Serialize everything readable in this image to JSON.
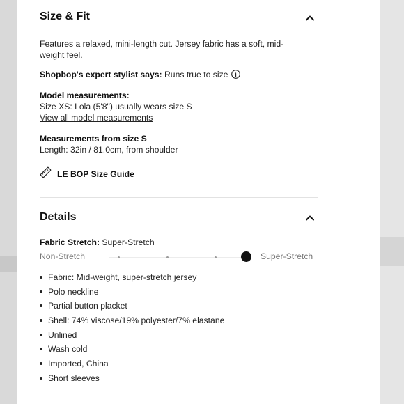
{
  "size_fit": {
    "title": "Size & Fit",
    "description_line1": "Features a relaxed, mini-length cut. Jersey fabric has a soft, mid-",
    "description_line2": "weight feel.",
    "stylist_label": "Shopbop's expert stylist says:",
    "stylist_value": " Runs true to size",
    "model_heading": "Model measurements:",
    "model_text": "Size XS: Lola (5'8\") usually wears size S",
    "model_link": "View all model measurements",
    "measure_heading": "Measurements from size S",
    "measure_text": "Length: 32in / 81.0cm, from shoulder",
    "size_guide_link": "LE BOP Size Guide",
    "icons": {
      "collapse": "chevron-up-icon",
      "info": "info-icon",
      "ruler": "ruler-icon"
    }
  },
  "details": {
    "title": "Details",
    "stretch_label": "Fabric Stretch:",
    "stretch_value": " Super-Stretch",
    "stretch_min": "Non-Stretch",
    "stretch_max": "Super-Stretch",
    "stretch_level": 1.0,
    "bullets": [
      "Fabric: Mid-weight, super-stretch jersey",
      "Polo neckline",
      "Partial button placket",
      "Shell: 74% viscose/19% polyester/7% elastane",
      "Unlined",
      "Wash cold",
      "Imported, China",
      "Short sleeves"
    ]
  },
  "colors": {
    "text": "#222222",
    "divider": "#e2e2e2",
    "muted": "#777777",
    "knob": "#111111"
  }
}
